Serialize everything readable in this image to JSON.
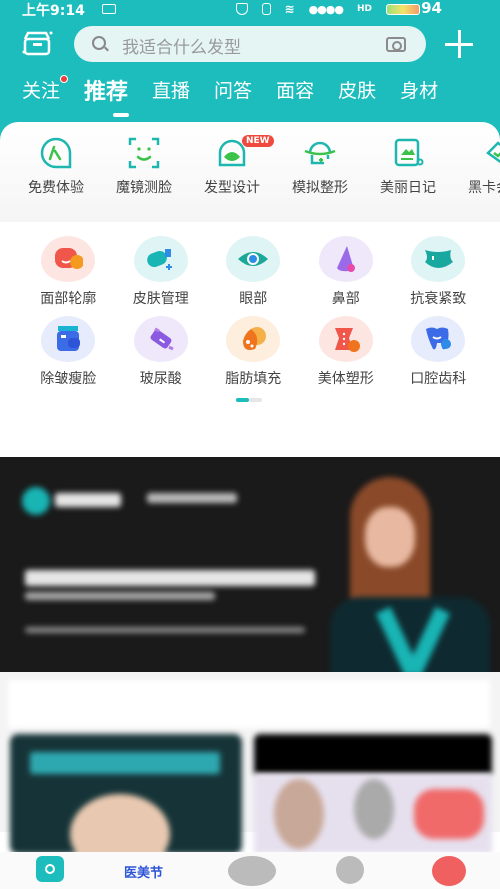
{
  "status_bar": {
    "time": "上午9:14",
    "battery_percent": "94",
    "icons": [
      "message-icon",
      "shield-icon",
      "vibrate-icon",
      "wifi-icon",
      "signal-icon",
      "hd-icon",
      "battery-icon"
    ]
  },
  "toolbar": {
    "left_icon": "gift-box-icon",
    "search_placeholder": "我适合什么发型",
    "camera_icon": "camera-icon",
    "plus_icon": "plus-icon"
  },
  "tabs": [
    {
      "label": "关注",
      "has_dot": true
    },
    {
      "label": "推荐",
      "active": true
    },
    {
      "label": "直播"
    },
    {
      "label": "问答"
    },
    {
      "label": "面容"
    },
    {
      "label": "皮肤"
    },
    {
      "label": "身材"
    }
  ],
  "tools": [
    {
      "label": "免费体验",
      "icon": "free-trial-icon"
    },
    {
      "label": "魔镜测脸",
      "icon": "face-scan-icon"
    },
    {
      "label": "发型设计",
      "icon": "hairstyle-icon",
      "badge": "NEW"
    },
    {
      "label": "模拟整形",
      "icon": "simulate-surgery-icon"
    },
    {
      "label": "美丽日记",
      "icon": "diary-icon"
    },
    {
      "label": "黑卡会员",
      "icon": "black-card-icon"
    }
  ],
  "categories": [
    {
      "label": "面部轮廓",
      "icon": "face-contour-icon",
      "bg": "#fde6e2",
      "color": "#f0564a"
    },
    {
      "label": "皮肤管理",
      "icon": "skin-care-icon",
      "bg": "#dff4f4",
      "color": "#19b4b4"
    },
    {
      "label": "眼部",
      "icon": "eye-icon",
      "bg": "#dff4f4",
      "color": "#19a89a"
    },
    {
      "label": "鼻部",
      "icon": "nose-icon",
      "bg": "#efe8fb",
      "color": "#9a6ae8"
    },
    {
      "label": "抗衰紧致",
      "icon": "anti-aging-icon",
      "bg": "#dff4f4",
      "color": "#19a8a0"
    },
    {
      "label": "除皱瘦脸",
      "icon": "botox-icon",
      "bg": "#e6ecfb",
      "color": "#3c6be8"
    },
    {
      "label": "玻尿酸",
      "icon": "hyaluronic-icon",
      "bg": "#efe8fb",
      "color": "#8a5ae0"
    },
    {
      "label": "脂肪填充",
      "icon": "fat-fill-icon",
      "bg": "#fdeedd",
      "color": "#f0731e"
    },
    {
      "label": "美体塑形",
      "icon": "body-shape-icon",
      "bg": "#fde6e2",
      "color": "#f0564a"
    },
    {
      "label": "口腔齿科",
      "icon": "dental-icon",
      "bg": "#e6ecfb",
      "color": "#3c6be8"
    }
  ],
  "pager": {
    "pages": 2,
    "current": 1
  },
  "bottom_nav": [
    {
      "icon": "home-camera-icon",
      "active": true
    },
    {
      "icon": "festival-icon",
      "label": "医美节"
    },
    {
      "icon": "chat-icon"
    },
    {
      "icon": "bubble-icon"
    },
    {
      "icon": "profile-avatar-icon"
    }
  ],
  "colors": {
    "brand": "#1ebdbd",
    "notification": "#ef3d3d",
    "badge_new": "#ef4a3d"
  }
}
